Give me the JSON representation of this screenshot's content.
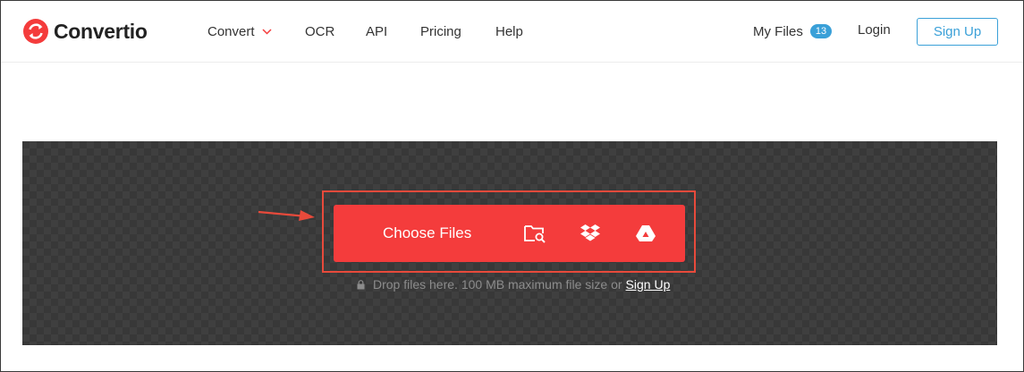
{
  "brand": {
    "name": "Convertio",
    "accent": "#f43c3c",
    "link_color": "#3aa0d8"
  },
  "nav": {
    "items": [
      {
        "label": "Convert",
        "has_dropdown": true
      },
      {
        "label": "OCR"
      },
      {
        "label": "API"
      },
      {
        "label": "Pricing"
      },
      {
        "label": "Help"
      }
    ],
    "my_files": {
      "label": "My Files",
      "count": "13"
    },
    "login_label": "Login",
    "signup_label": "Sign Up"
  },
  "upload": {
    "choose_label": "Choose Files",
    "sources": [
      "folder-search-icon",
      "dropbox-icon",
      "google-drive-icon"
    ],
    "hint_text": "Drop files here. 100 MB maximum file size or",
    "hint_link": "Sign Up"
  }
}
